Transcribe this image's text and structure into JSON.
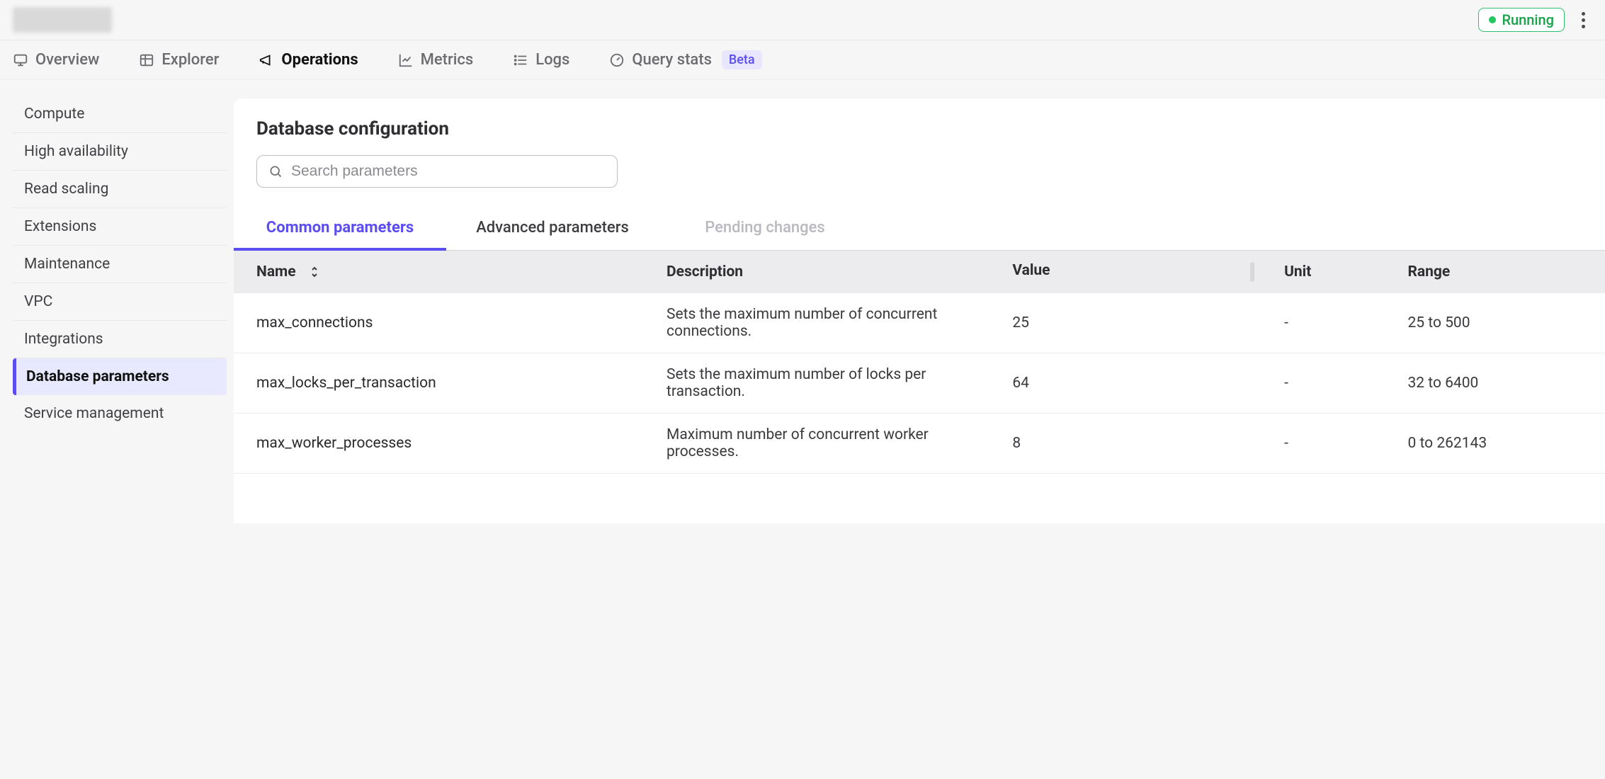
{
  "header": {
    "status_label": "Running"
  },
  "nav": {
    "items": [
      {
        "key": "overview",
        "label": "Overview",
        "active": false
      },
      {
        "key": "explorer",
        "label": "Explorer",
        "active": false
      },
      {
        "key": "operations",
        "label": "Operations",
        "active": true
      },
      {
        "key": "metrics",
        "label": "Metrics",
        "active": false
      },
      {
        "key": "logs",
        "label": "Logs",
        "active": false
      },
      {
        "key": "querystats",
        "label": "Query stats",
        "active": false,
        "badge": "Beta"
      }
    ]
  },
  "sidebar": {
    "items": [
      {
        "label": "Compute"
      },
      {
        "label": "High availability"
      },
      {
        "label": "Read scaling"
      },
      {
        "label": "Extensions"
      },
      {
        "label": "Maintenance"
      },
      {
        "label": "VPC"
      },
      {
        "label": "Integrations"
      },
      {
        "label": "Database parameters",
        "active": true
      },
      {
        "label": "Service management"
      }
    ]
  },
  "panel": {
    "title": "Database configuration",
    "search_placeholder": "Search parameters"
  },
  "subtabs": {
    "items": [
      {
        "label": "Common parameters",
        "state": "active"
      },
      {
        "label": "Advanced parameters",
        "state": "normal"
      },
      {
        "label": "Pending changes",
        "state": "disabled"
      }
    ]
  },
  "table": {
    "columns": [
      {
        "key": "name",
        "label": "Name",
        "sortable": true
      },
      {
        "key": "desc",
        "label": "Description"
      },
      {
        "key": "value",
        "label": "Value"
      },
      {
        "key": "unit",
        "label": "Unit"
      },
      {
        "key": "range",
        "label": "Range"
      }
    ],
    "rows": [
      {
        "name": "max_connections",
        "desc": "Sets the maximum number of concurrent connections.",
        "value": "25",
        "unit": "-",
        "range": "25 to 500"
      },
      {
        "name": "max_locks_per_transaction",
        "desc": "Sets the maximum number of locks per transaction.",
        "value": "64",
        "unit": "-",
        "range": "32 to 6400"
      },
      {
        "name": "max_worker_processes",
        "desc": "Maximum number of concurrent worker processes.",
        "value": "8",
        "unit": "-",
        "range": "0 to 262143"
      }
    ]
  }
}
